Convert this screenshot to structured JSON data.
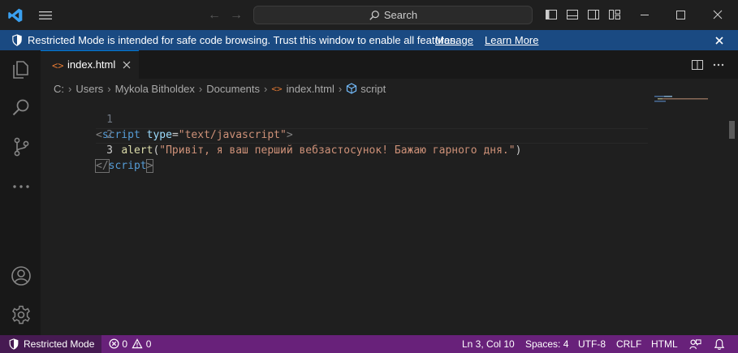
{
  "titlebar": {
    "search_label": "Search"
  },
  "banner": {
    "message": "Restricted Mode is intended for safe code browsing. Trust this window to enable all features.",
    "manage_link": "Manage",
    "learn_more_link": "Learn More"
  },
  "tab": {
    "name": "index.html"
  },
  "breadcrumb": {
    "items": [
      "C:",
      "Users",
      "Mykola Bitholdex",
      "Documents",
      "index.html",
      "script"
    ]
  },
  "code": {
    "line_numbers": [
      "1",
      "2",
      "3"
    ],
    "line1": {
      "open_br": "<",
      "tag": "script",
      "attr": "type",
      "eq": "=",
      "value": "\"text/javascript\"",
      "close_br": ">"
    },
    "line2": {
      "indent": "    ",
      "fn": "alert",
      "open_paren": "(",
      "string": "\"Привіт, я ваш перший вебзастосунок! Бажаю гарного дня.\"",
      "close_paren": ")"
    },
    "line3": {
      "open_br": "</",
      "tag": "script",
      "close_br": ">"
    }
  },
  "statusbar": {
    "restricted_mode": "Restricted Mode",
    "errors": "0",
    "warnings": "0",
    "cursor_position": "Ln 3, Col 10",
    "spaces": "Spaces: 4",
    "encoding": "UTF-8",
    "eol": "CRLF",
    "language": "HTML"
  },
  "colors": {
    "banner_bg": "#1a4a82",
    "statusbar_bg": "#68217a",
    "restricted_bg": "#461a52",
    "accent": "#0078d4"
  }
}
